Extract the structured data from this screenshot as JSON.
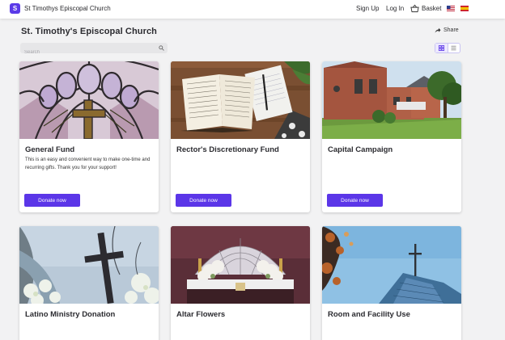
{
  "header": {
    "logo_letter": "S",
    "brand": "St Timothys Episcopal Church",
    "sign_up": "Sign Up",
    "log_in": "Log In",
    "basket": "Basket",
    "flags": [
      "us-flag-icon",
      "es-flag-icon"
    ]
  },
  "page": {
    "title": "St. Timothy's Episcopal Church",
    "share": "Share"
  },
  "search": {
    "placeholder": "Search",
    "value": ""
  },
  "view_toggle": {
    "active": "grid"
  },
  "cards": [
    {
      "title": "General Fund",
      "description": "This is an easy and convenient way to make one-time and recurring gifts. Thank you for your support!",
      "button": "Donate now",
      "image": "stained-glass-window"
    },
    {
      "title": "Rector's Discretionary Fund",
      "description": "",
      "button": "Donate now",
      "image": "open-bible-and-notebook"
    },
    {
      "title": "Capital Campaign",
      "description": "",
      "button": "Donate now",
      "image": "church-building-exterior"
    },
    {
      "title": "Latino Ministry Donation",
      "description": "",
      "image": "cross-among-blossoms"
    },
    {
      "title": "Altar Flowers",
      "description": "",
      "image": "church-altar-with-flowers"
    },
    {
      "title": "Room and Facility Use",
      "description": "",
      "image": "steeple-cross-sky"
    }
  ],
  "colors": {
    "accent": "#5b36e8",
    "background": "#f2f2f3"
  }
}
